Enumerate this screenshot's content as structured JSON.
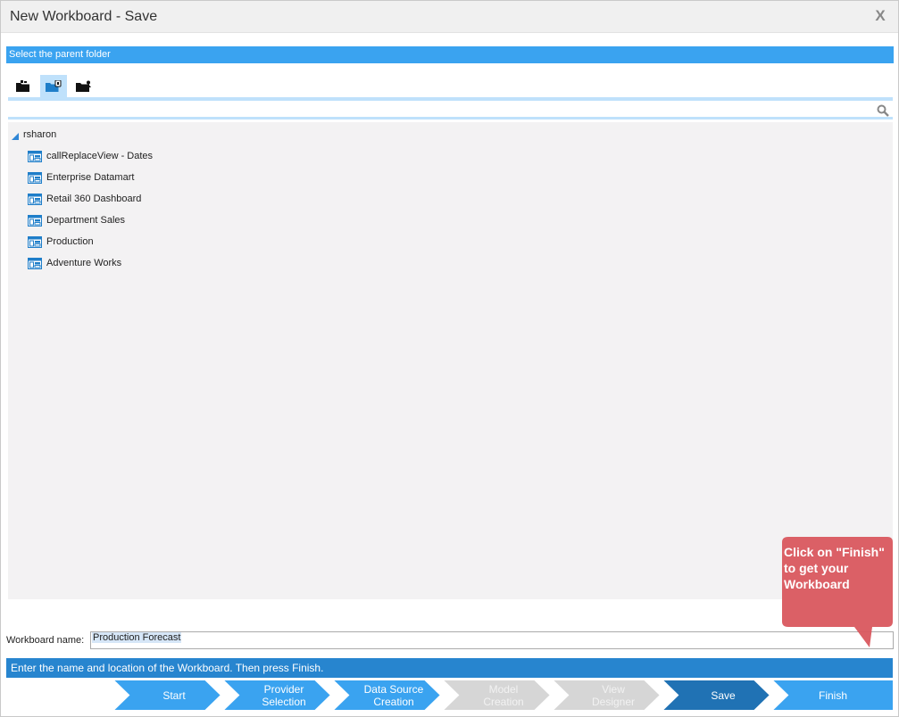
{
  "window": {
    "title": "New Workboard - Save",
    "close_glyph": "X"
  },
  "section": {
    "title": "Select the parent folder"
  },
  "tabs": [
    {
      "icon": "folder-icon",
      "active": false
    },
    {
      "icon": "shared-folder-icon",
      "active": true
    },
    {
      "icon": "user-folder-icon",
      "active": false
    }
  ],
  "tree": {
    "root": "rsharon",
    "items": [
      "callReplaceView - Dates",
      "Enterprise Datamart",
      "Retail 360 Dashboard",
      "Department Sales",
      "Production",
      "Adventure Works"
    ]
  },
  "form": {
    "name_label": "Workboard name:",
    "name_value": "Production Forecast"
  },
  "status": {
    "message": "Enter the name and location of the Workboard. Then press Finish."
  },
  "wizard": {
    "steps": [
      {
        "label": "Start",
        "state": "done"
      },
      {
        "label": "Provider\nSelection",
        "state": "done"
      },
      {
        "label": "Data Source\nCreation",
        "state": "done"
      },
      {
        "label": "Model\nCreation",
        "state": "disabled"
      },
      {
        "label": "View\nDesigner",
        "state": "disabled"
      },
      {
        "label": "Save",
        "state": "current"
      },
      {
        "label": "Finish",
        "state": "next"
      }
    ]
  },
  "callout": {
    "text": "Click on \"Finish\" to get your Workboard"
  },
  "colors": {
    "accent": "#3aa3f0",
    "status_bar": "#2785cf",
    "step_done": "#3aa3f0",
    "step_disabled": "#d6d6d6",
    "step_current": "#2072b4",
    "callout": "#d9575e"
  }
}
